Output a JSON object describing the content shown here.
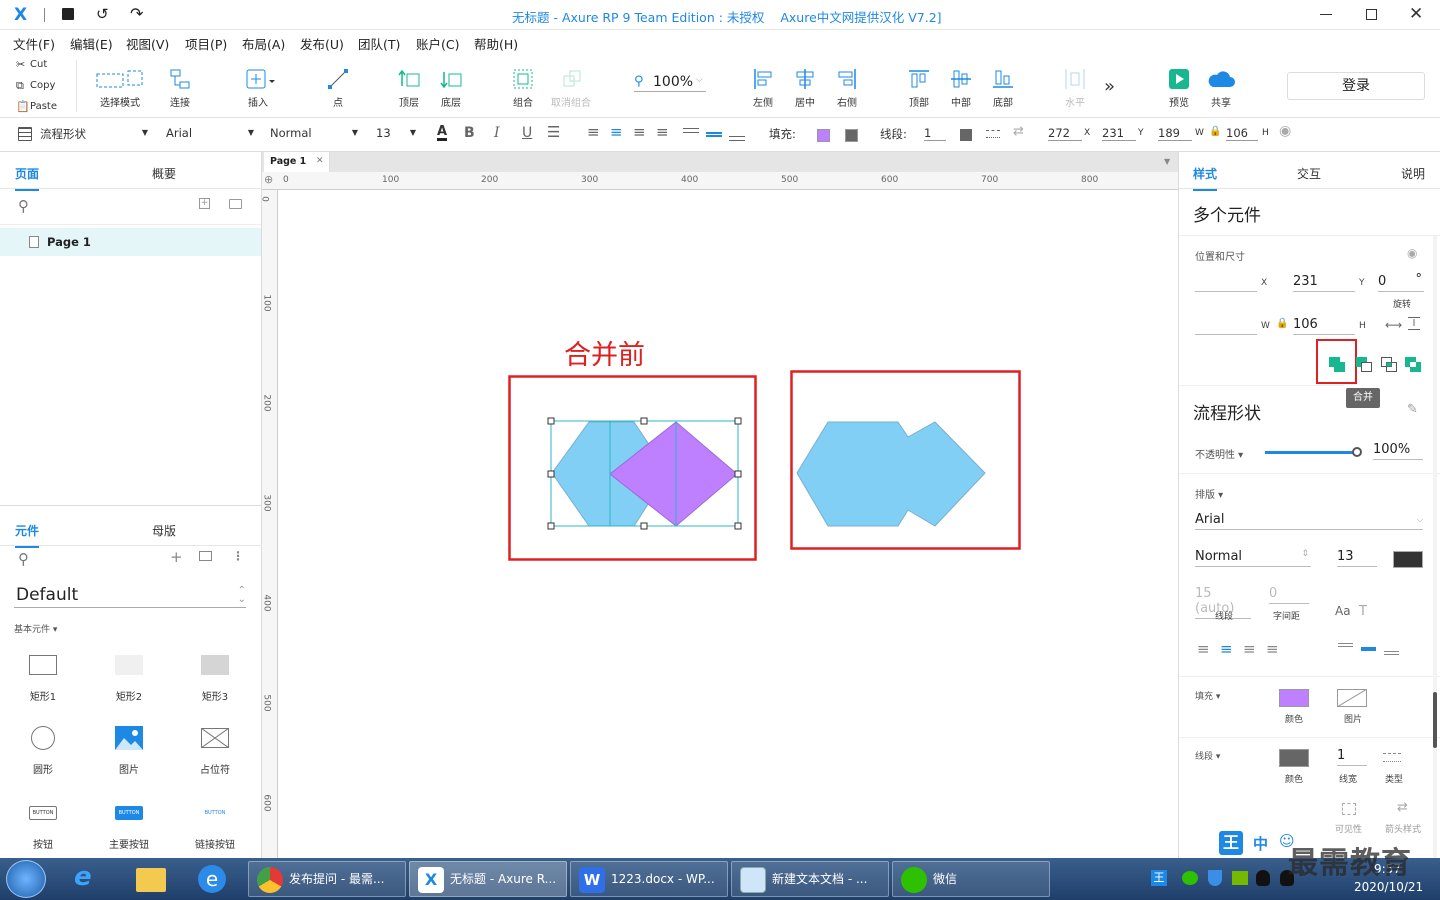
{
  "app": {
    "window_title_prefix": "无标题 - Axure RP 9 Team Edition : ",
    "window_title_license": "未授权",
    "window_title_suffix": "Axure中文网提供汉化 V7.2]"
  },
  "menu": [
    "文件(F)",
    "编辑(E)",
    "视图(V)",
    "项目(P)",
    "布局(A)",
    "发布(U)",
    "团队(T)",
    "账户(C)",
    "帮助(H)"
  ],
  "clipboard": {
    "cut": "Cut",
    "copy": "Copy",
    "paste": "Paste"
  },
  "toolbar": {
    "select_mode": "选择模式",
    "connect": "连接",
    "insert": "插入",
    "point": "点",
    "top_layer": "顶层",
    "bottom_layer": "底层",
    "group": "组合",
    "ungroup": "取消组合",
    "zoom": "100%",
    "left": "左侧",
    "center": "居中",
    "right": "右侧",
    "top": "顶部",
    "middle": "中部",
    "bottom": "底部",
    "horizontal": "水平",
    "preview": "预览",
    "share": "共享",
    "login": "登录"
  },
  "format": {
    "style": "流程形状",
    "font": "Arial",
    "weight": "Normal",
    "size": "13",
    "fill_label": "填充:",
    "stroke_label": "线段:",
    "stroke_width": "1",
    "x": "272",
    "y": "231",
    "w": "189",
    "h": "106",
    "x_lbl": "X",
    "y_lbl": "Y",
    "w_lbl": "W",
    "h_lbl": "H"
  },
  "left": {
    "tab_pages": "页面",
    "tab_outline": "概要",
    "page_item": "Page 1",
    "tab_widgets": "元件",
    "tab_masters": "母版",
    "library": "Default",
    "category": "基本元件",
    "widgets": [
      "矩形1",
      "矩形2",
      "矩形3",
      "圆形",
      "图片",
      "占位符",
      "按钮",
      "主要按钮",
      "链接按钮"
    ],
    "button_text": "BUTTON"
  },
  "canvas": {
    "page_tab": "Page 1",
    "ruler_h": [
      "0",
      "100",
      "200",
      "300",
      "400",
      "500",
      "600",
      "700",
      "800"
    ],
    "ruler_v": [
      "0",
      "100",
      "200",
      "300",
      "400",
      "500",
      "600"
    ],
    "annotation": "合并前"
  },
  "right": {
    "tab_style": "样式",
    "tab_interaction": "交互",
    "tab_notes": "说明",
    "selection_title": "多个元件",
    "pos_size": "位置和尺寸",
    "x_lbl": "X",
    "y_val": "231",
    "y_lbl": "Y",
    "rotation": "0",
    "rotation_unit": "°",
    "rotation_lbl": "旋转",
    "w_lbl": "W",
    "h_val": "106",
    "h_lbl": "H",
    "tooltip": "合并",
    "style_name": "流程形状",
    "opacity_lbl": "不透明性",
    "opacity_val": "100%",
    "opacity": 1.0,
    "typography_lbl": "排版",
    "font": "Arial",
    "weight": "Normal",
    "size": "13",
    "line_height": "15 (auto)",
    "line_height_lbl": "线段",
    "char_spacing": "0",
    "char_spacing_lbl": "字间距",
    "fill_lbl": "填充",
    "color_lbl": "颜色",
    "image_lbl": "图片",
    "stroke_lbl": "线段",
    "stroke_color_lbl": "颜色",
    "stroke_width": "1",
    "stroke_width_lbl": "线宽",
    "stroke_type_lbl": "类型",
    "visible_lbl": "可见性",
    "arrow_lbl": "箭头样式"
  },
  "taskbar": {
    "items": [
      "发布提问 - 最需...",
      "无标题 - Axure R...",
      "1223.docx - WP...",
      "新建文本文档 - ...",
      "微信"
    ],
    "time": "9:57",
    "date": "2020/10/21",
    "ime": "中"
  },
  "watermark": "最需教育",
  "colors": {
    "accent": "#1e88e5",
    "hexagon": "#81cff4",
    "diamond": "#bf80ff",
    "highlight_box": "#e02020",
    "teal": "#17b890"
  }
}
